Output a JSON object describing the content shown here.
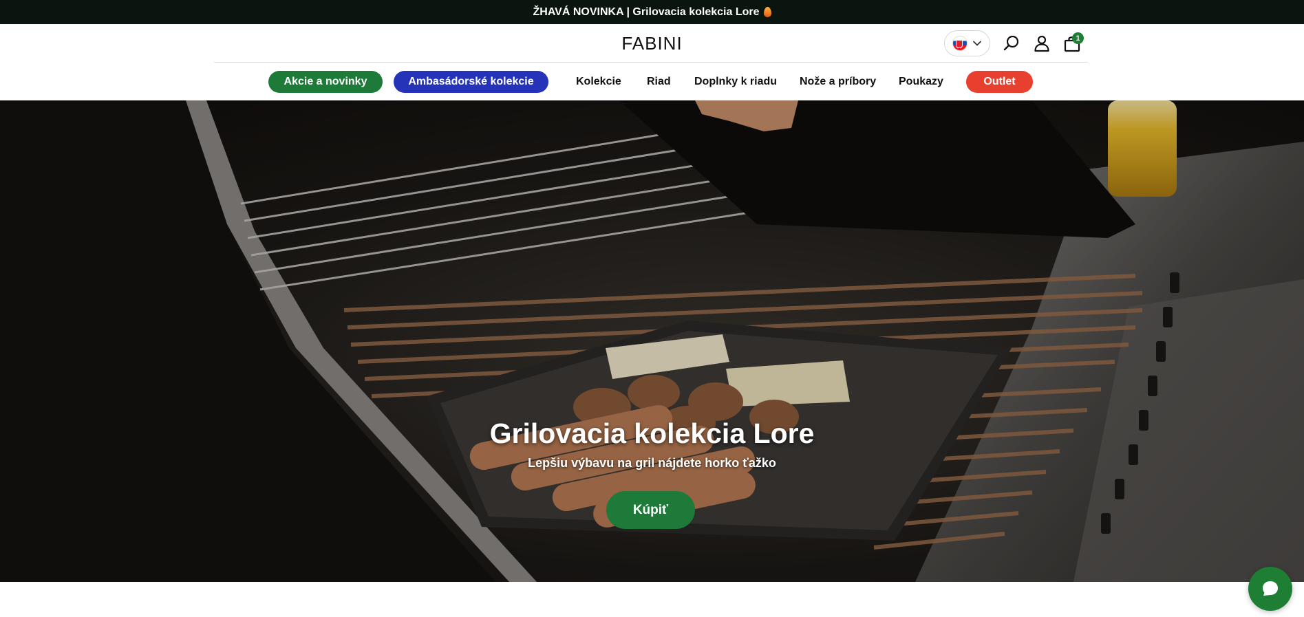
{
  "announcement": {
    "text": "ŽHAVÁ NOVINKA | Grilovacia kolekcia Lore",
    "icon": "flame-icon"
  },
  "header": {
    "logo": "FABINI",
    "language": {
      "selected": "SK",
      "flag_icon": "slovakia-flag-icon"
    },
    "icons": [
      "search-icon",
      "account-icon",
      "cart-icon"
    ],
    "cart_count": "1"
  },
  "nav": {
    "items": [
      {
        "label": "Akcie a novinky",
        "style": "pill",
        "color": "#1e7a38"
      },
      {
        "label": "Ambasádorské kolekcie",
        "style": "pill",
        "color": "#2433b8"
      },
      {
        "label": "Kolekcie",
        "style": "link"
      },
      {
        "label": "Riad",
        "style": "link"
      },
      {
        "label": "Doplnky k riadu",
        "style": "link"
      },
      {
        "label": "Nože a príbory",
        "style": "link"
      },
      {
        "label": "Poukazy",
        "style": "link"
      },
      {
        "label": "Outlet",
        "style": "pill",
        "color": "#e8402e"
      }
    ]
  },
  "hero": {
    "title": "Grilovacia kolekcia Lore",
    "subtitle": "Lepšiu výbavu na gril nájdete horko ťažko",
    "cta": "Kúpiť"
  },
  "chat": {
    "icon": "chat-bubble-icon"
  },
  "colors": {
    "accent_green": "#1e7a38",
    "accent_blue": "#2433b8",
    "accent_red": "#e8402e",
    "topbar": "#0b1510"
  }
}
